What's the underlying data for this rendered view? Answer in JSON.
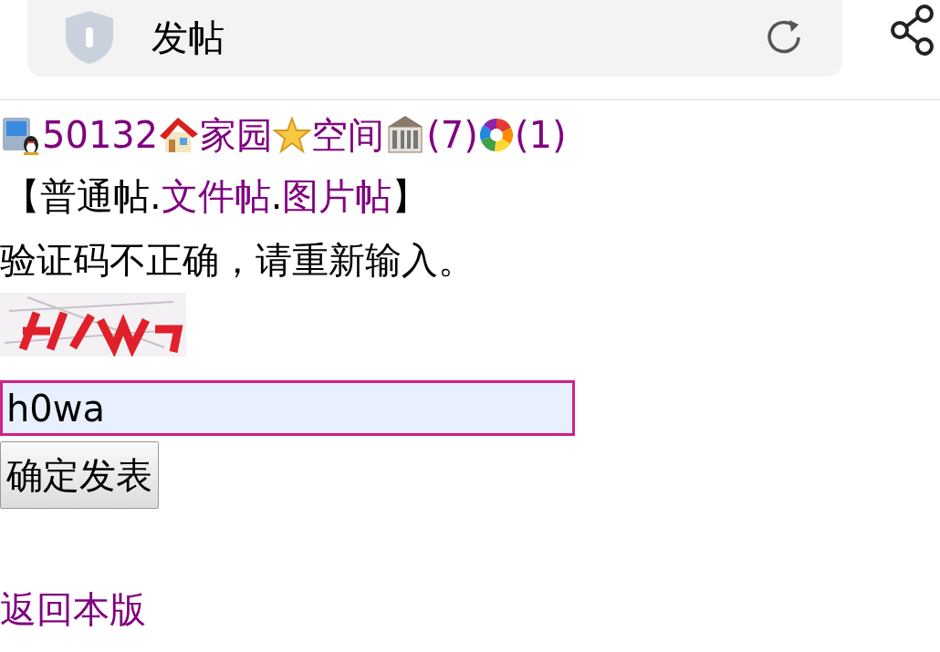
{
  "address_bar": {
    "title": "发帖"
  },
  "user_links": [
    {
      "kind": "pc",
      "label": "50132"
    },
    {
      "kind": "home",
      "label": "家园"
    },
    {
      "kind": "star",
      "label": "空间"
    },
    {
      "kind": "building",
      "label": "(7)"
    },
    {
      "kind": "aperture",
      "label": "(1)"
    }
  ],
  "post_types": [
    {
      "kind": "text",
      "label": "【"
    },
    {
      "kind": "text",
      "label": "普通帖"
    },
    {
      "kind": "text",
      "label": "."
    },
    {
      "kind": "link",
      "label": "文件帖"
    },
    {
      "kind": "text",
      "label": "."
    },
    {
      "kind": "link",
      "label": "图片帖"
    },
    {
      "kind": "text",
      "label": "】"
    }
  ],
  "error_message": "验证码不正确，请重新输入。",
  "captcha_field": {
    "value": "h0wa"
  },
  "submit_button": "确定发表",
  "back_link": "返回本版"
}
